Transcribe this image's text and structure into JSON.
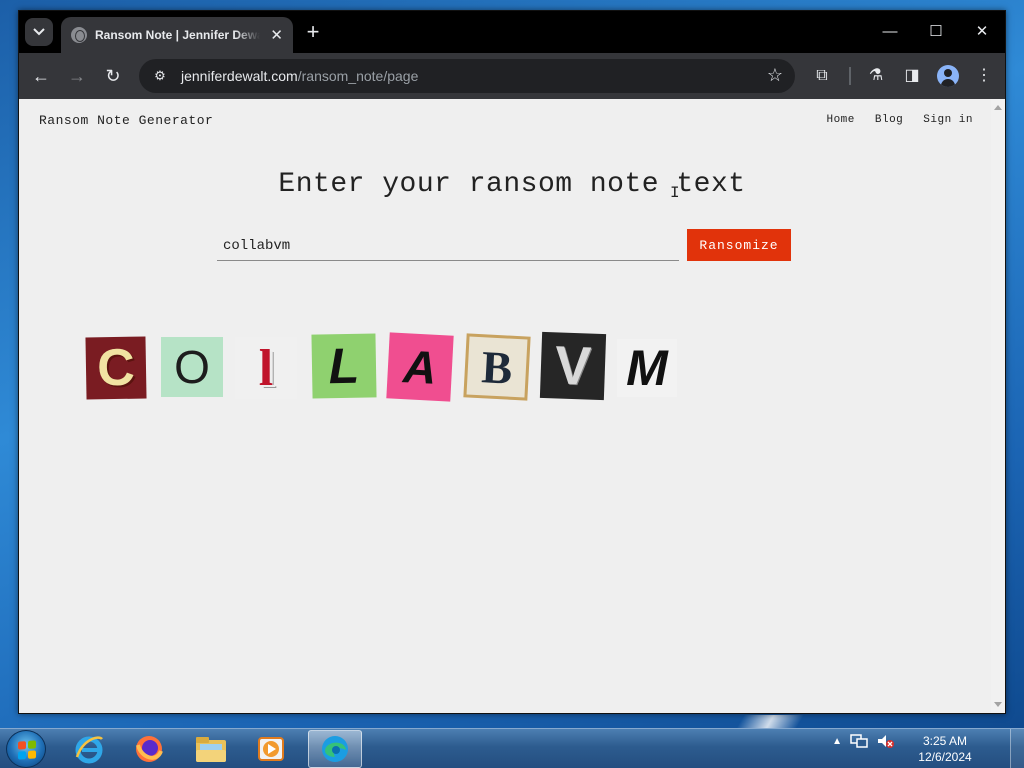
{
  "browser": {
    "tab_title": "Ransom Note | Jennifer Dewalt",
    "url_domain": "jenniferdewalt.com",
    "url_path": "/ransom_note/page"
  },
  "page": {
    "brand": "Ransom Note Generator",
    "nav": [
      "Home",
      "Blog",
      "Sign in"
    ],
    "heading": "Enter your ransom note text",
    "input_value": "collabvm",
    "button_label": "Ransomize",
    "accent_color": "#e1330b",
    "letters": [
      "C",
      "O",
      "l",
      "L",
      "A",
      "B",
      "V",
      "M"
    ]
  },
  "taskbar": {
    "apps": [
      "internet-explorer",
      "firefox",
      "file-explorer",
      "media-player",
      "edge"
    ],
    "time": "3:25 AM",
    "date": "12/6/2024"
  }
}
